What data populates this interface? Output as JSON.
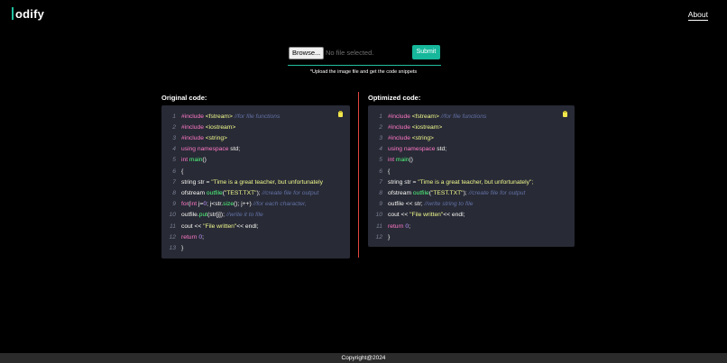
{
  "header": {
    "logo_text": "odify",
    "about_label": "About"
  },
  "upload": {
    "browse_label": "Browse...",
    "file_status": "No file selected.",
    "submit_label": "Submit",
    "hint": "*Upload the image file and get the code snippets"
  },
  "panels": {
    "original": {
      "title": "Original code:",
      "lines": [
        {
          "num": "1",
          "tokens": [
            {
              "t": "#include ",
              "c": "#ff79c6",
              "b": true
            },
            {
              "t": "<fstream>",
              "c": "#f1fa8c"
            },
            {
              "t": " //for file functions",
              "c": "#6272a4",
              "i": true
            }
          ]
        },
        {
          "num": "2",
          "tokens": [
            {
              "t": "#include ",
              "c": "#ff79c6",
              "b": true
            },
            {
              "t": "<iostream>",
              "c": "#f1fa8c"
            }
          ]
        },
        {
          "num": "3",
          "tokens": [
            {
              "t": "#include ",
              "c": "#ff79c6",
              "b": true
            },
            {
              "t": "<string>",
              "c": "#f1fa8c"
            }
          ]
        },
        {
          "num": "4",
          "tokens": [
            {
              "t": "using namespace ",
              "c": "#ff79c6",
              "b": true
            },
            {
              "t": "std;",
              "c": "#f8f8f2"
            }
          ]
        },
        {
          "num": "5",
          "tokens": [
            {
              "t": "int ",
              "c": "#ff79c6",
              "b": true
            },
            {
              "t": "main",
              "c": "#50fa7b"
            },
            {
              "t": "()",
              "c": "#f8f8f2"
            }
          ]
        },
        {
          "num": "6",
          "tokens": [
            {
              "t": "{",
              "c": "#f8f8f2"
            }
          ]
        },
        {
          "num": "7",
          "tokens": [
            {
              "t": "string str = ",
              "c": "#f8f8f2"
            },
            {
              "t": "\"Time is a great teacher, but unfortunately",
              "c": "#f1fa8c"
            }
          ]
        },
        {
          "num": "8",
          "tokens": [
            {
              "t": "ofstream ",
              "c": "#f8f8f2"
            },
            {
              "t": "outfile",
              "c": "#50fa7b"
            },
            {
              "t": "(",
              "c": "#f8f8f2"
            },
            {
              "t": "\"TEST.TXT\"",
              "c": "#f1fa8c"
            },
            {
              "t": "); ",
              "c": "#f8f8f2"
            },
            {
              "t": "//create file for output",
              "c": "#6272a4",
              "i": true
            }
          ]
        },
        {
          "num": "9",
          "tokens": [
            {
              "t": "for",
              "c": "#ff79c6",
              "b": true
            },
            {
              "t": "(",
              "c": "#f8f8f2"
            },
            {
              "t": "int ",
              "c": "#ff79c6",
              "b": true
            },
            {
              "t": "j=",
              "c": "#f8f8f2"
            },
            {
              "t": "0",
              "c": "#bd93f9"
            },
            {
              "t": "; j<str.",
              "c": "#f8f8f2"
            },
            {
              "t": "size",
              "c": "#50fa7b"
            },
            {
              "t": "(); j++) ",
              "c": "#f8f8f2"
            },
            {
              "t": "//for each character,",
              "c": "#6272a4",
              "i": true
            }
          ]
        },
        {
          "num": "10",
          "tokens": [
            {
              "t": "outfile.",
              "c": "#f8f8f2"
            },
            {
              "t": "put",
              "c": "#50fa7b"
            },
            {
              "t": "(str[j]); ",
              "c": "#f8f8f2"
            },
            {
              "t": "//write it to file",
              "c": "#6272a4",
              "i": true
            }
          ]
        },
        {
          "num": "11",
          "tokens": [
            {
              "t": "cout << ",
              "c": "#f8f8f2"
            },
            {
              "t": "\"File written\"",
              "c": "#f1fa8c"
            },
            {
              "t": "<< endl;",
              "c": "#f8f8f2"
            }
          ]
        },
        {
          "num": "12",
          "tokens": [
            {
              "t": "return ",
              "c": "#ff79c6",
              "b": true
            },
            {
              "t": "0",
              "c": "#bd93f9"
            },
            {
              "t": ";",
              "c": "#f8f8f2"
            }
          ]
        },
        {
          "num": "13",
          "tokens": [
            {
              "t": "}",
              "c": "#f8f8f2"
            }
          ]
        }
      ]
    },
    "optimized": {
      "title": "Optimized code:",
      "lines": [
        {
          "num": "1",
          "tokens": [
            {
              "t": "#include ",
              "c": "#ff79c6",
              "b": true
            },
            {
              "t": "<fstream>",
              "c": "#f1fa8c"
            },
            {
              "t": " //for file functions",
              "c": "#6272a4",
              "i": true
            }
          ]
        },
        {
          "num": "2",
          "tokens": [
            {
              "t": "#include ",
              "c": "#ff79c6",
              "b": true
            },
            {
              "t": "<iostream>",
              "c": "#f1fa8c"
            }
          ]
        },
        {
          "num": "3",
          "tokens": [
            {
              "t": "#include ",
              "c": "#ff79c6",
              "b": true
            },
            {
              "t": "<string>",
              "c": "#f1fa8c"
            }
          ]
        },
        {
          "num": "4",
          "tokens": [
            {
              "t": "using namespace ",
              "c": "#ff79c6",
              "b": true
            },
            {
              "t": "std;",
              "c": "#f8f8f2"
            }
          ]
        },
        {
          "num": "5",
          "tokens": [
            {
              "t": "int ",
              "c": "#ff79c6",
              "b": true
            },
            {
              "t": "main",
              "c": "#50fa7b"
            },
            {
              "t": "()",
              "c": "#f8f8f2"
            }
          ]
        },
        {
          "num": "6",
          "tokens": [
            {
              "t": "{",
              "c": "#f8f8f2"
            }
          ]
        },
        {
          "num": "7",
          "tokens": [
            {
              "t": "string str = ",
              "c": "#f8f8f2"
            },
            {
              "t": "\"Time is a great teacher, but unfortunately\";",
              "c": "#f1fa8c"
            }
          ]
        },
        {
          "num": "8",
          "tokens": [
            {
              "t": "ofstream ",
              "c": "#f8f8f2"
            },
            {
              "t": "outfile",
              "c": "#50fa7b"
            },
            {
              "t": "(",
              "c": "#f8f8f2"
            },
            {
              "t": "\"TEST.TXT\"",
              "c": "#f1fa8c"
            },
            {
              "t": "); ",
              "c": "#f8f8f2"
            },
            {
              "t": "//create file for output",
              "c": "#6272a4",
              "i": true
            }
          ]
        },
        {
          "num": "9",
          "tokens": [
            {
              "t": "outfile << str; ",
              "c": "#f8f8f2"
            },
            {
              "t": "//write string to file",
              "c": "#6272a4",
              "i": true
            }
          ]
        },
        {
          "num": "10",
          "tokens": [
            {
              "t": "cout << ",
              "c": "#f8f8f2"
            },
            {
              "t": "\"File written\"",
              "c": "#f1fa8c"
            },
            {
              "t": "<< endl;",
              "c": "#f8f8f2"
            }
          ]
        },
        {
          "num": "11",
          "tokens": [
            {
              "t": "return ",
              "c": "#ff79c6",
              "b": true
            },
            {
              "t": "0",
              "c": "#bd93f9"
            },
            {
              "t": ";",
              "c": "#f8f8f2"
            }
          ]
        },
        {
          "num": "12",
          "tokens": [
            {
              "t": "}",
              "c": "#f8f8f2"
            }
          ]
        }
      ]
    }
  },
  "icons": {
    "copy": "clipboard-icon"
  },
  "colors": {
    "accent": "#16b79b",
    "divider": "#e0473f",
    "code_bg": "#282a36"
  },
  "footer": {
    "copyright": "Copyright@2024"
  }
}
